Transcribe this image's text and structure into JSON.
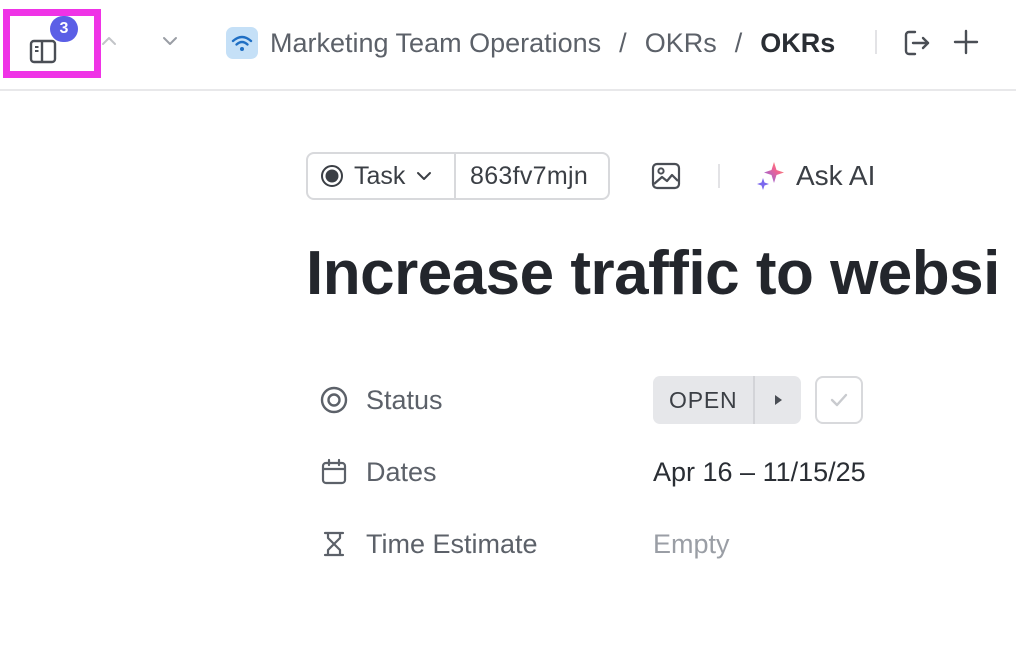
{
  "topbar": {
    "badge_count": "3",
    "breadcrumb": {
      "space": "Marketing Team Operations",
      "folder": "OKRs",
      "list": "OKRs",
      "separator": "/"
    }
  },
  "task": {
    "type_label": "Task",
    "id": "863fv7mjn",
    "ask_ai_label": "Ask AI",
    "title": "Increase traffic to websi"
  },
  "properties": {
    "status": {
      "label": "Status",
      "value": "OPEN"
    },
    "dates": {
      "label": "Dates",
      "value": "Apr 16 – 11/15/25"
    },
    "time_estimate": {
      "label": "Time Estimate",
      "value": "Empty"
    }
  },
  "colors": {
    "highlight": "#ef33e6",
    "badge": "#5b5fe6",
    "space_icon_bg": "#c5e0f7"
  }
}
